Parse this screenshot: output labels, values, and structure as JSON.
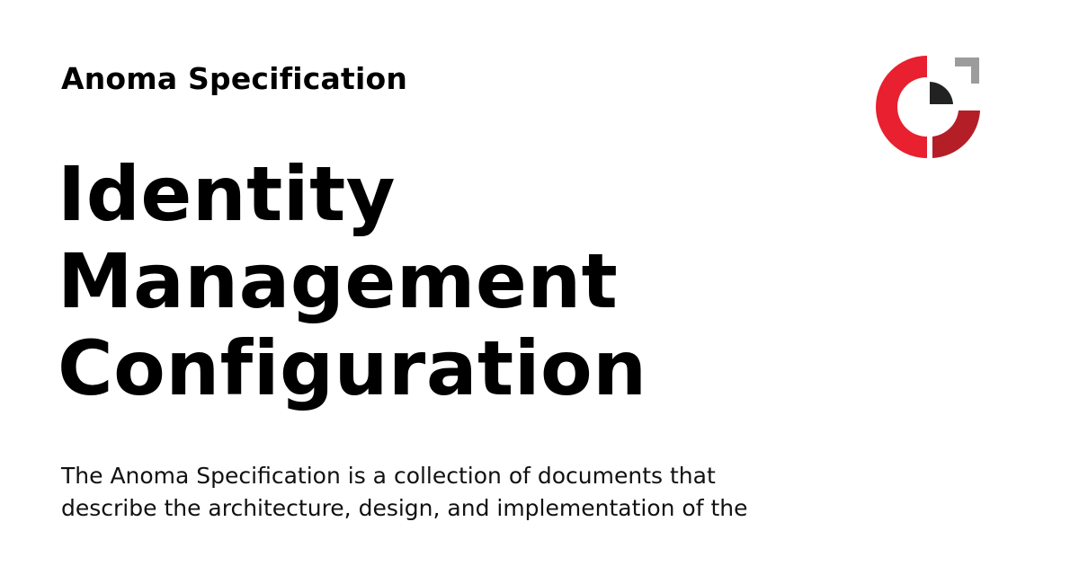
{
  "header": {
    "site_name": "Anoma Specification"
  },
  "title": {
    "lines": [
      "Identity",
      "Management",
      "Configuration"
    ]
  },
  "description": {
    "lines": [
      "The Anoma Specification is a collection of documents that",
      "describe the architecture, design, and implementation of the"
    ]
  },
  "logo": {
    "icon": "anoma-logo-icon",
    "colors": {
      "ring_red": "#e8202f",
      "ring_dark_red": "#b41f27",
      "corner_gray": "#9c9c9c",
      "center_black": "#222222"
    }
  }
}
